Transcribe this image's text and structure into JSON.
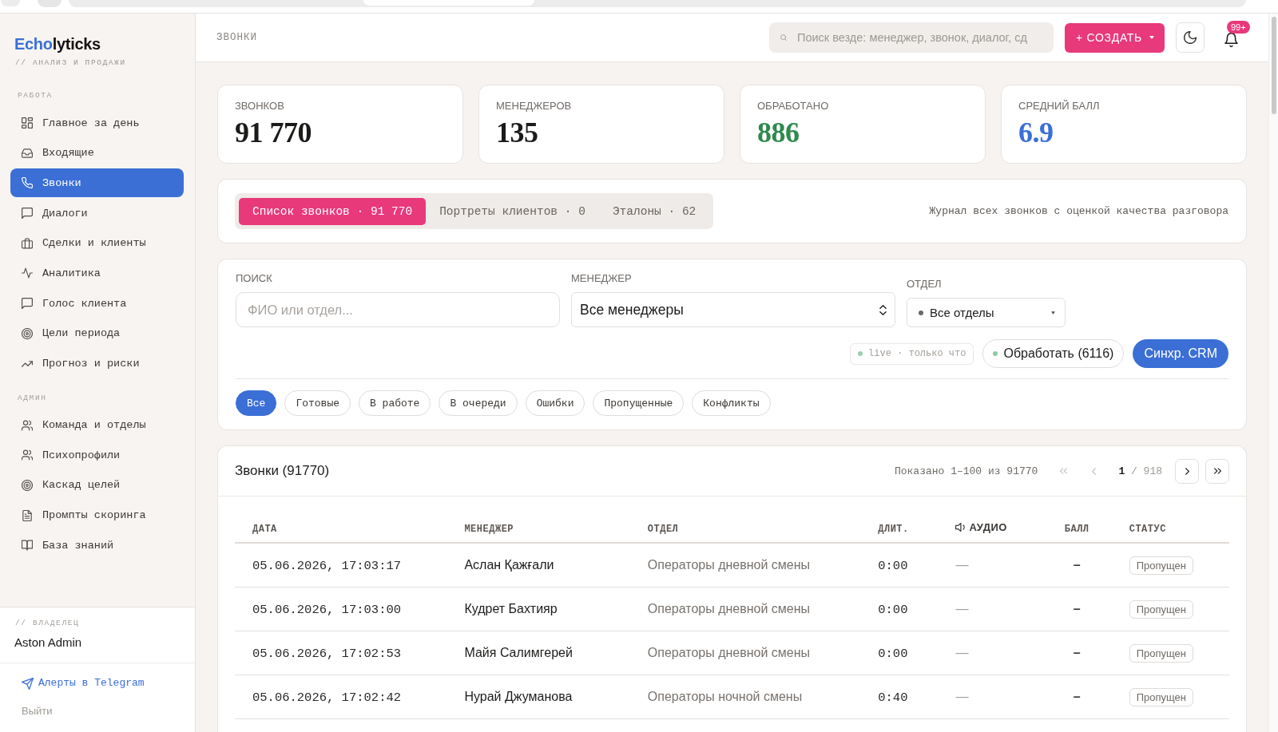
{
  "sidebar": {
    "logo": {
      "accent": "Echo",
      "rest": "lyticks"
    },
    "tagline": "// АНАЛИЗ И ПРОДАЖИ",
    "sections": [
      {
        "title": "РАБОТА",
        "items": [
          {
            "label": "Главное за день",
            "selected": false
          },
          {
            "label": "Входящие",
            "selected": false
          },
          {
            "label": "Звонки",
            "selected": true
          },
          {
            "label": "Диалоги",
            "selected": false
          },
          {
            "label": "Сделки и клиенты",
            "selected": false
          },
          {
            "label": "Аналитика",
            "selected": false
          },
          {
            "label": "Голос клиента",
            "selected": false
          },
          {
            "label": "Цели периода",
            "selected": false
          },
          {
            "label": "Прогноз и риски",
            "selected": false
          }
        ]
      },
      {
        "title": "АДМИН",
        "items": [
          {
            "label": "Команда и отделы",
            "selected": false
          },
          {
            "label": "Психопрофили",
            "selected": false
          },
          {
            "label": "Каскад целей",
            "selected": false
          },
          {
            "label": "Промпты скоринга",
            "selected": false
          },
          {
            "label": "База знаний",
            "selected": false
          }
        ]
      }
    ],
    "owner": {
      "caption": "// ВЛАДЕЛЕЦ",
      "name": "Aston Admin"
    },
    "links": [
      {
        "label": "Алерты в Telegram",
        "kind": "alert"
      },
      {
        "label": "Выйти",
        "kind": "logout"
      }
    ]
  },
  "header": {
    "title": "ЗВОНКИ",
    "search": {
      "placeholder": "Поиск везде: менеджер, звонок, диалог, сд"
    },
    "create_button": "+ СОЗДАТЬ",
    "notifications_badge": "99+"
  },
  "stats": [
    {
      "label": "ЗВОНКОВ",
      "value": "91 770",
      "color": "#1c1b1a"
    },
    {
      "label": "МЕНЕДЖЕРОВ",
      "value": "135",
      "color": "#1c1b1a"
    },
    {
      "label": "ОБРАБОТАНО",
      "value": "886",
      "color": "#2f8a4c"
    },
    {
      "label": "СРЕДНИЙ БАЛЛ",
      "value": "6.9",
      "color": "#3a6fd8"
    }
  ],
  "view_tabs": {
    "tabs": [
      {
        "label": "Список звонков · 91 770",
        "selected": true
      },
      {
        "label": "Портреты клиентов · 0",
        "selected": false
      },
      {
        "label": "Эталоны · 62",
        "selected": false
      }
    ],
    "note": "Журнал всех звонков с оценкой качества разговора"
  },
  "filters": {
    "search": {
      "label": "ПОИСК",
      "placeholder": "ФИО или отдел..."
    },
    "manager": {
      "label": "МЕНЕДЖЕР",
      "value": "Все менеджеры"
    },
    "department": {
      "label": "ОТДЕЛ",
      "value": "Все отделы"
    },
    "live_status": "live · только что",
    "process_button": "Обработать (6116)",
    "sync_button": "Синхр. CRM",
    "chips": [
      {
        "label": "Все",
        "selected": true
      },
      {
        "label": "Готовые",
        "selected": false
      },
      {
        "label": "В работе",
        "selected": false
      },
      {
        "label": "В очереди",
        "selected": false
      },
      {
        "label": "Ошибки",
        "selected": false
      },
      {
        "label": "Пропущенные",
        "selected": false
      },
      {
        "label": "Конфликты",
        "selected": false
      }
    ]
  },
  "table": {
    "title": "Звонки (91770)",
    "range": "Показано 1–100 из 91770",
    "pagination": {
      "page": "**1** / 918",
      "buttons": [
        {
          "kind": "first",
          "disabled": true
        },
        {
          "kind": "prev",
          "disabled": true
        },
        {
          "kind": "next",
          "disabled": false
        },
        {
          "kind": "last",
          "disabled": false
        }
      ]
    },
    "columns": [
      {
        "label": "ДАТА",
        "kind": "text"
      },
      {
        "label": "МЕНЕДЖЕР",
        "kind": "text"
      },
      {
        "label": "ОТДЕЛ",
        "kind": "text"
      },
      {
        "label": "ДЛИТ.",
        "kind": "text"
      },
      {
        "label": "АУДИО",
        "kind": "audio"
      },
      {
        "label": "БАЛЛ",
        "kind": "text"
      },
      {
        "label": "СТАТУС",
        "kind": "text"
      }
    ],
    "rows": [
      {
        "date": "05.06.2026, 17:03:17",
        "manager": "Аслан Қажғали",
        "department": "Операторы дневной смены",
        "duration": "0:00",
        "audio": "—",
        "score": "–",
        "status": "Пропущен"
      },
      {
        "date": "05.06.2026, 17:03:00",
        "manager": "Кудрет Бахтияр",
        "department": "Операторы дневной смены",
        "duration": "0:00",
        "audio": "—",
        "score": "–",
        "status": "Пропущен"
      },
      {
        "date": "05.06.2026, 17:02:53",
        "manager": "Майя Салимгерей",
        "department": "Операторы дневной смены",
        "duration": "0:00",
        "audio": "—",
        "score": "–",
        "status": "Пропущен"
      },
      {
        "date": "05.06.2026, 17:02:42",
        "manager": "Нурай Джуманова",
        "department": "Операторы ночной смены",
        "duration": "0:40",
        "audio": "—",
        "score": "–",
        "status": "Пропущен"
      }
    ]
  }
}
